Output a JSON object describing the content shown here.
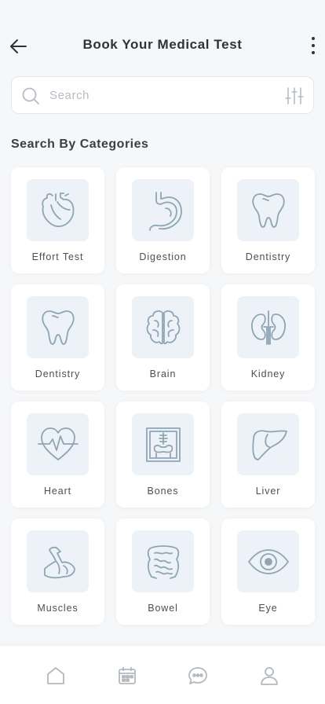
{
  "header": {
    "title": "Book Your Medical Test"
  },
  "search": {
    "placeholder": "Search"
  },
  "section": {
    "title": "Search By Categories"
  },
  "categories": [
    {
      "label": "Effort Test",
      "icon": "heart-organ-icon"
    },
    {
      "label": "Digestion",
      "icon": "stomach-icon"
    },
    {
      "label": "Dentistry",
      "icon": "tooth-icon"
    },
    {
      "label": "Dentistry",
      "icon": "tooth-icon"
    },
    {
      "label": "Brain",
      "icon": "brain-icon"
    },
    {
      "label": "Kidney",
      "icon": "kidney-icon"
    },
    {
      "label": "Heart",
      "icon": "heartbeat-icon"
    },
    {
      "label": "Bones",
      "icon": "xray-bones-icon"
    },
    {
      "label": "Liver",
      "icon": "liver-icon"
    },
    {
      "label": "Muscles",
      "icon": "muscle-arm-icon"
    },
    {
      "label": "Bowel",
      "icon": "intestine-icon"
    },
    {
      "label": "Eye",
      "icon": "eye-icon"
    }
  ],
  "bottom_nav": [
    "home-icon",
    "calendar-icon",
    "chat-icon",
    "profile-icon"
  ],
  "colors": {
    "icon_stroke": "#8fa5b4",
    "icon_bg": "#ecf2f7",
    "nav_icon": "#b3b9bf"
  }
}
